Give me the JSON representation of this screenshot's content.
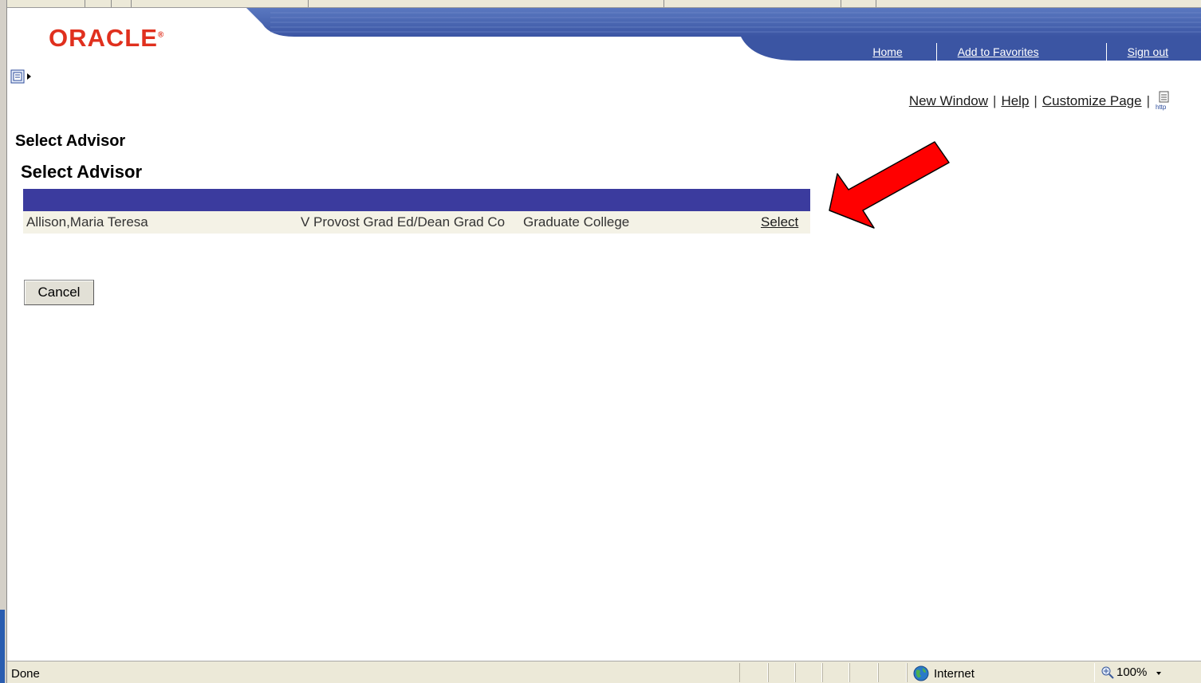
{
  "header": {
    "logo_text": "ORACLE",
    "nav": [
      {
        "label": "Home"
      },
      {
        "label": "Add to Favorites"
      },
      {
        "label": "Sign out"
      }
    ]
  },
  "sublinks": {
    "new_window": "New Window",
    "help": "Help",
    "customize": "Customize Page",
    "separator": "|"
  },
  "page": {
    "title": "Select Advisor",
    "subtitle": "Select Advisor"
  },
  "grid": {
    "rows": [
      {
        "name": "Allison,Maria Teresa",
        "title": "V Provost Grad Ed/Dean Grad Co",
        "department": "Graduate College",
        "action": "Select"
      }
    ]
  },
  "buttons": {
    "cancel": "Cancel"
  },
  "status": {
    "left": "Done",
    "zone": "Internet",
    "zoom": "100%"
  },
  "colors": {
    "brand_red": "#e0301e",
    "banner_blue": "#3b55a3",
    "grid_header": "#3b3b9e",
    "annotation_arrow": "#ff0000"
  }
}
